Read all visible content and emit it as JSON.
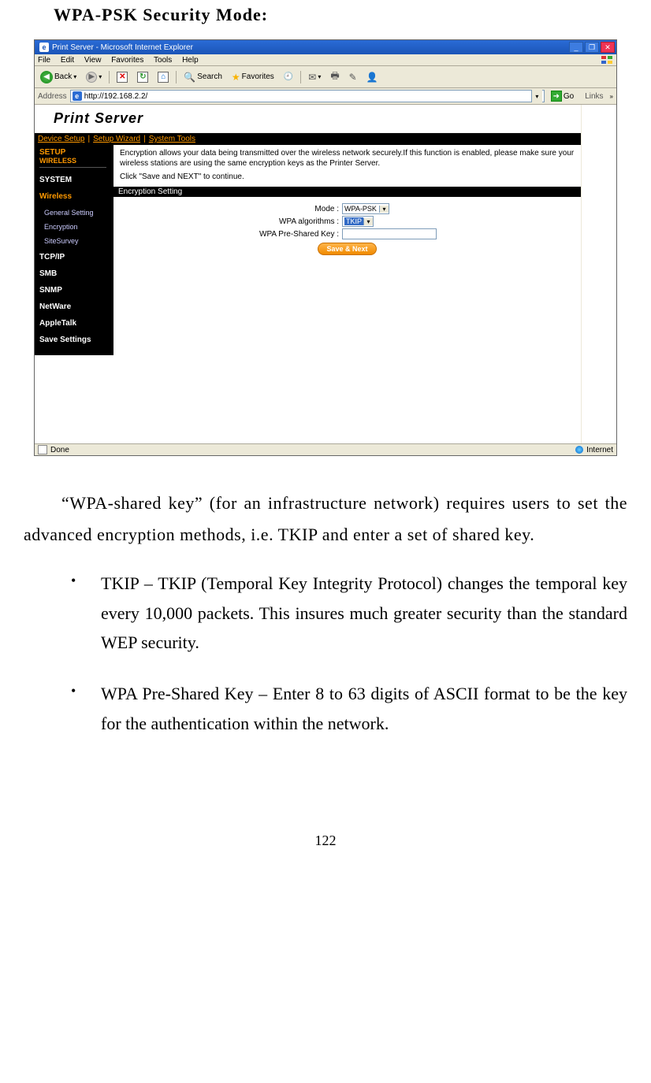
{
  "heading": "WPA-PSK Security Mode:",
  "browser": {
    "title": "Print Server - Microsoft Internet Explorer",
    "menus": [
      "File",
      "Edit",
      "View",
      "Favorites",
      "Tools",
      "Help"
    ],
    "toolbar": {
      "back": "Back",
      "search": "Search",
      "favorites": "Favorites"
    },
    "address_label": "Address",
    "url": "http://192.168.2.2/",
    "go": "Go",
    "links": "Links",
    "status_left": "Done",
    "status_right": "Internet"
  },
  "app": {
    "title": "Print Server",
    "top_tabs": [
      "Device Setup",
      "Setup Wizard",
      "System Tools"
    ],
    "sidebar": {
      "setup": "SETUP",
      "wireless_hdr": "WIRELESS",
      "items": [
        {
          "label": "SYSTEM",
          "type": "item"
        },
        {
          "label": "Wireless",
          "type": "active"
        },
        {
          "label": "General Setting",
          "type": "sub"
        },
        {
          "label": "Encryption",
          "type": "sub"
        },
        {
          "label": "SiteSurvey",
          "type": "sub"
        },
        {
          "label": "TCP/IP",
          "type": "item"
        },
        {
          "label": "SMB",
          "type": "item"
        },
        {
          "label": "SNMP",
          "type": "item"
        },
        {
          "label": "NetWare",
          "type": "item"
        },
        {
          "label": "AppleTalk",
          "type": "item"
        },
        {
          "label": "Save Settings",
          "type": "item"
        }
      ]
    },
    "description_line1": "Encryption allows your data being transmitted over the wireless network securely.If this function is enabled, please make sure your wireless stations are using the same encryption keys as the Printer Server.",
    "description_line2": "Click \"Save and NEXT\" to continue.",
    "section_header": "Encryption Setting",
    "fields": {
      "mode_label": "Mode :",
      "mode_value": "WPA-PSK",
      "algo_label": "WPA algorithms :",
      "algo_value": "TKIP",
      "psk_label": "WPA Pre-Shared Key :",
      "psk_value": ""
    },
    "button": "Save & Next"
  },
  "body_para": "“WPA-shared key” (for an infrastructure network) requires users to set the advanced encryption methods, i.e. TKIP and enter a set of shared key.",
  "bullets": [
    "TKIP – TKIP (Temporal Key Integrity Protocol) changes the temporal key every 10,000 packets. This insures much greater security than the standard WEP security.",
    "WPA Pre-Shared Key – Enter 8 to 63 digits of ASCII format to be the key for the authentication within the network."
  ],
  "page_number": "122"
}
